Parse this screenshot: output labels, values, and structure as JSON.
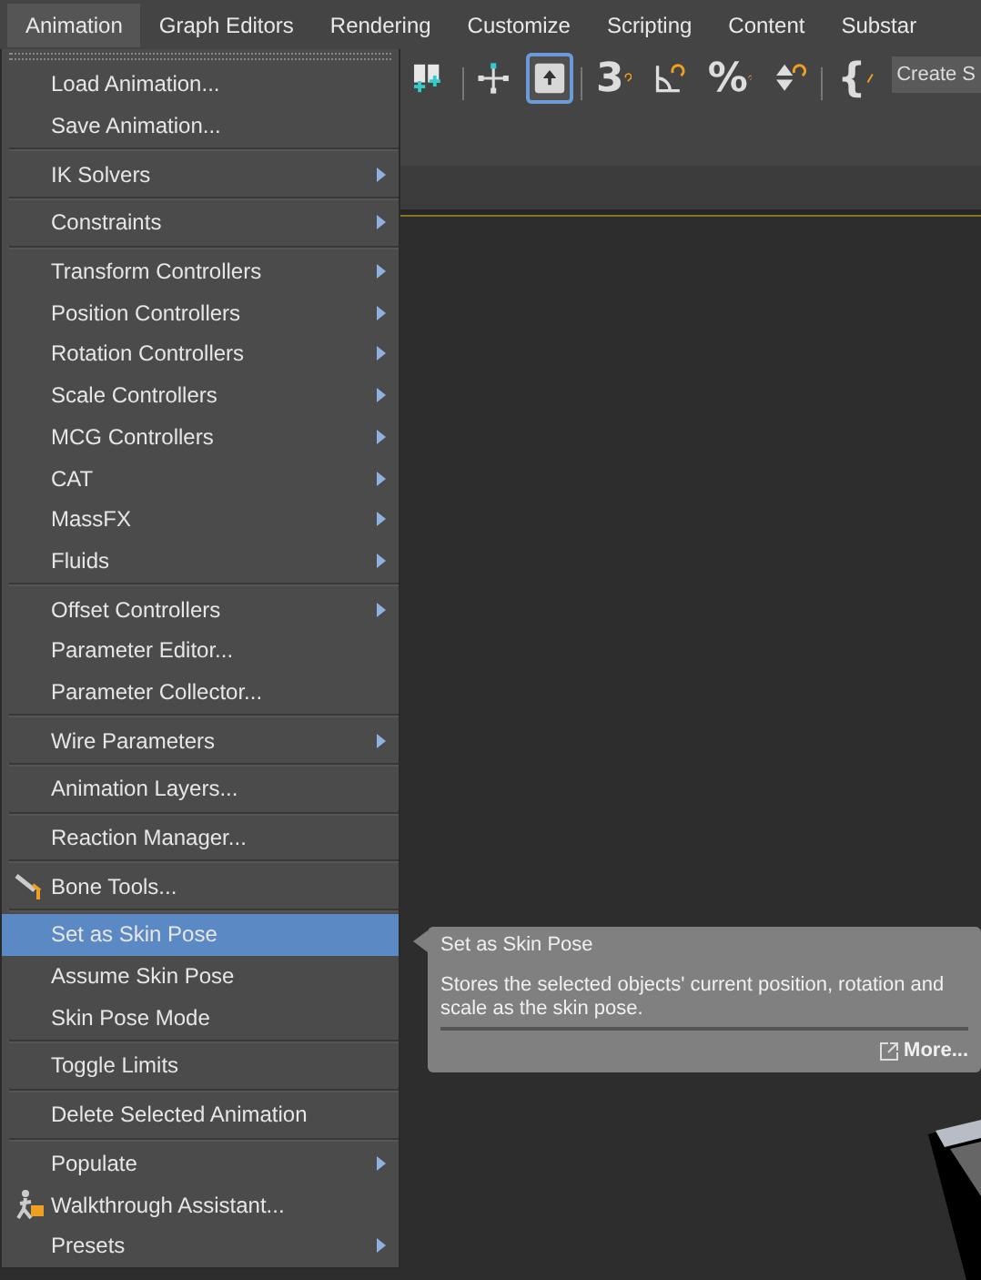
{
  "menubar": [
    {
      "label": "Animation",
      "selected": true
    },
    {
      "label": "Graph Editors",
      "selected": false
    },
    {
      "label": "Rendering",
      "selected": false
    },
    {
      "label": "Customize",
      "selected": false
    },
    {
      "label": "Scripting",
      "selected": false
    },
    {
      "label": "Content",
      "selected": false
    },
    {
      "label": "Substar",
      "selected": false
    }
  ],
  "toolbar": {
    "tools": [
      {
        "kind": "place",
        "selected": false
      },
      {
        "kind": "move",
        "selected": false
      },
      {
        "kind": "select",
        "selected": true
      },
      {
        "kind": "snap",
        "glyph": "3",
        "selected": false
      },
      {
        "kind": "angle",
        "selected": false
      },
      {
        "kind": "percent",
        "glyph": "%",
        "selected": false
      },
      {
        "kind": "spinner",
        "selected": false
      },
      {
        "kind": "script",
        "glyph": "{",
        "selected": false
      }
    ],
    "field": "Create S"
  },
  "menu": {
    "groups": [
      [
        {
          "label": "Load Animation...",
          "submenu": false,
          "selected": false
        },
        {
          "label": "Save Animation...",
          "submenu": false,
          "selected": false
        }
      ],
      [
        {
          "label": "IK Solvers",
          "submenu": true,
          "selected": false
        }
      ],
      [
        {
          "label": "Constraints",
          "submenu": true,
          "selected": false
        }
      ],
      [
        {
          "label": "Transform Controllers",
          "submenu": true,
          "selected": false
        },
        {
          "label": "Position Controllers",
          "submenu": true,
          "selected": false
        },
        {
          "label": "Rotation Controllers",
          "submenu": true,
          "selected": false
        },
        {
          "label": "Scale Controllers",
          "submenu": true,
          "selected": false
        },
        {
          "label": "MCG Controllers",
          "submenu": true,
          "selected": false
        },
        {
          "label": "CAT",
          "submenu": true,
          "selected": false
        },
        {
          "label": "MassFX",
          "submenu": true,
          "selected": false
        },
        {
          "label": "Fluids",
          "submenu": true,
          "selected": false
        }
      ],
      [
        {
          "label": "Offset Controllers",
          "submenu": true,
          "selected": false
        },
        {
          "label": "Parameter Editor...",
          "submenu": false,
          "selected": false
        },
        {
          "label": "Parameter Collector...",
          "submenu": false,
          "selected": false
        }
      ],
      [
        {
          "label": "Wire Parameters",
          "submenu": true,
          "selected": false
        }
      ],
      [
        {
          "label": "Animation Layers...",
          "submenu": false,
          "selected": false
        }
      ],
      [
        {
          "label": "Reaction Manager...",
          "submenu": false,
          "selected": false
        }
      ],
      [
        {
          "label": "Bone Tools...",
          "submenu": false,
          "selected": false,
          "kind": "bone"
        }
      ],
      [
        {
          "label": "Set as Skin Pose",
          "submenu": false,
          "selected": true
        },
        {
          "label": "Assume Skin Pose",
          "submenu": false,
          "selected": false
        },
        {
          "label": "Skin Pose Mode",
          "submenu": false,
          "selected": false
        }
      ],
      [
        {
          "label": "Toggle Limits",
          "submenu": false,
          "selected": false
        }
      ],
      [
        {
          "label": "Delete Selected Animation",
          "submenu": false,
          "selected": false
        }
      ],
      [
        {
          "label": "Populate",
          "submenu": true,
          "selected": false
        },
        {
          "label": "Walkthrough Assistant...",
          "submenu": false,
          "selected": false,
          "kind": "walker"
        },
        {
          "label": "Presets",
          "submenu": true,
          "selected": false
        }
      ]
    ]
  },
  "tooltip": {
    "title": "Set as Skin Pose",
    "description": "Stores the selected objects' current position, rotation and scale as the skin pose.",
    "link": "More..."
  }
}
